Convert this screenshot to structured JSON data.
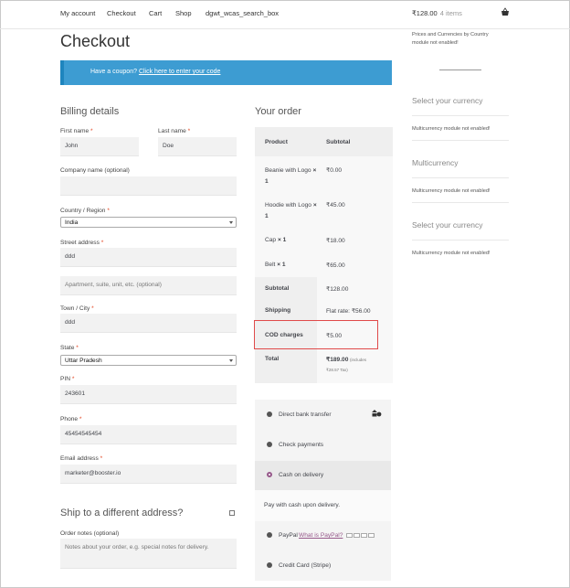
{
  "nav": {
    "items": [
      "My account",
      "Checkout",
      "Cart",
      "Shop",
      "dgwt_wcas_search_box"
    ],
    "cart_total": "₹128.00",
    "cart_count": "4 items"
  },
  "page_title": "Checkout",
  "coupon": {
    "prompt": "Have a coupon?",
    "link": "Click here to enter your code"
  },
  "billing": {
    "heading": "Billing details",
    "first_name_label": "First name",
    "first_name": "John",
    "last_name_label": "Last name",
    "last_name": "Doe",
    "company_label": "Company name (optional)",
    "company": "",
    "country_label": "Country / Region",
    "country": "India",
    "street_label": "Street address",
    "street1": "ddd",
    "street2_placeholder": "Apartment, suite, unit, etc. (optional)",
    "town_label": "Town / City",
    "town": "ddd",
    "state_label": "State",
    "state": "Uttar Pradesh",
    "pin_label": "PIN",
    "pin": "243601",
    "phone_label": "Phone",
    "phone": "45454545454",
    "email_label": "Email address",
    "email": "marketer@booster.io",
    "required_mark": "*"
  },
  "ship": {
    "heading": "Ship to a different address?",
    "notes_label": "Order notes (optional)",
    "notes_placeholder": "Notes about your order, e.g. special notes for delivery."
  },
  "order": {
    "heading": "Your order",
    "col_product": "Product",
    "col_subtotal": "Subtotal",
    "items": [
      {
        "name": "Beanie with Logo",
        "qty": "× 1",
        "price": "₹0.00"
      },
      {
        "name": "Hoodie with Logo",
        "qty": "× 1",
        "price": "₹45.00"
      },
      {
        "name": "Cap",
        "qty": "× 1",
        "price": "₹18.00"
      },
      {
        "name": "Belt",
        "qty": "× 1",
        "price": "₹65.00"
      }
    ],
    "subtotal_label": "Subtotal",
    "subtotal": "₹128.00",
    "shipping_label": "Shipping",
    "shipping": "Flat rate: ₹56.00",
    "cod_label": "COD charges",
    "cod": "₹5.00",
    "total_label": "Total",
    "total": "₹189.00",
    "total_includes": "(includes",
    "total_tax": "₹28.57 Tax)"
  },
  "payment": {
    "methods": [
      "Direct bank transfer",
      "Check payments",
      "Cash on delivery",
      "PayPal",
      "Credit Card (Stripe)"
    ],
    "paypal_link": "What is PayPal?",
    "cod_description": "Pay with cash upon delivery.",
    "accent": "#96588a"
  },
  "sidebar": {
    "top_note": "Prices and Currencies by Country module not enabled!",
    "widgets": [
      {
        "title": "Select your currency",
        "note": "Multicurrency module not enabled!"
      },
      {
        "title": "Multicurrency",
        "note": "Multicurrency module not enabled!"
      },
      {
        "title": "Select your currency",
        "note": "Multicurrency module not enabled!"
      }
    ]
  }
}
